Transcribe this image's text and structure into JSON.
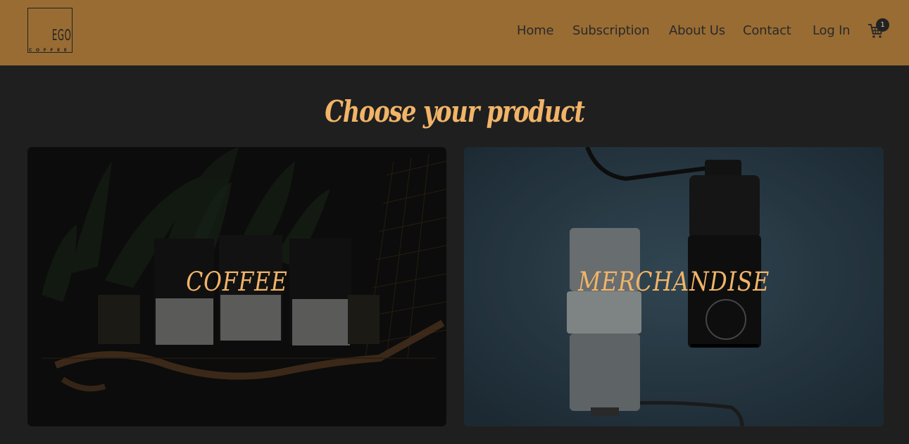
{
  "header": {
    "logo": {
      "brand": "EGO",
      "sub": "COFFEE"
    },
    "nav": [
      {
        "label": "Home"
      },
      {
        "label": "Subscription"
      },
      {
        "label": "About Us"
      },
      {
        "label": "Contact"
      },
      {
        "label": "Log In"
      }
    ],
    "cart": {
      "icon": "cart-icon",
      "count": "1"
    }
  },
  "main": {
    "title": "Choose your product",
    "cards": [
      {
        "label": "COFFEE",
        "image": "coffee-bags-on-shelf"
      },
      {
        "label": "MERCHANDISE",
        "image": "coffee-grinders"
      }
    ]
  },
  "colors": {
    "header_bg": "#996c33",
    "page_bg": "#1f1f1f",
    "accent": "#f1b468"
  }
}
